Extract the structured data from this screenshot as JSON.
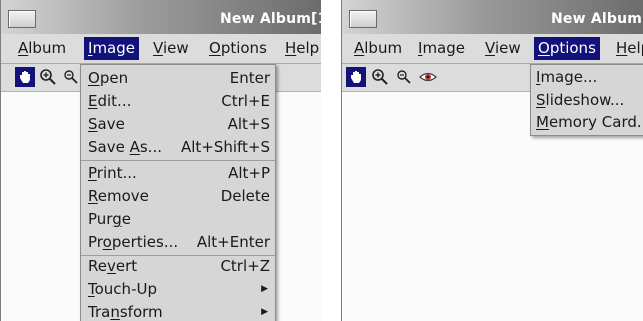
{
  "left": {
    "title": "New Album[1",
    "menus": [
      {
        "u": "A",
        "rest": "lbum"
      },
      {
        "u": "I",
        "rest": "mage"
      },
      {
        "u": "V",
        "rest": "iew"
      },
      {
        "u": "O",
        "rest": "ptions"
      },
      {
        "u": "H",
        "rest": "elp"
      }
    ],
    "active_menu": "Image",
    "toolbar_icons": [
      "hand-icon",
      "zoom-in-icon",
      "zoom-out-icon"
    ],
    "dropdown": [
      {
        "u": "O",
        "rest": "pen",
        "accel": "Enter"
      },
      {
        "u": "E",
        "rest": "dit...",
        "accel": "Ctrl+E"
      },
      {
        "u": "S",
        "rest": "ave",
        "accel": "Alt+S"
      },
      {
        "pre": "Save ",
        "u": "A",
        "rest": "s...",
        "accel": "Alt+Shift+S"
      },
      {
        "u": "P",
        "rest": "rint...",
        "accel": "Alt+P"
      },
      {
        "u": "R",
        "rest": "emove",
        "accel": "Delete"
      },
      {
        "pre": "Pur",
        "u": "g",
        "rest": "e",
        "accel": ""
      },
      {
        "pre": "Pr",
        "u": "o",
        "rest": "perties...",
        "accel": "Alt+Enter"
      },
      {
        "pre": "Re",
        "u": "v",
        "rest": "ert",
        "accel": "Ctrl+Z"
      },
      {
        "u": "T",
        "rest": "ouch-Up",
        "accel": "",
        "submenu": true
      },
      {
        "pre": "Tra",
        "u": "n",
        "rest": "sform",
        "accel": "",
        "submenu": true
      }
    ]
  },
  "right": {
    "title": "New Album",
    "menus": [
      {
        "u": "A",
        "rest": "lbum"
      },
      {
        "u": "I",
        "rest": "mage"
      },
      {
        "u": "V",
        "rest": "iew"
      },
      {
        "u": "O",
        "rest": "ptions"
      },
      {
        "u": "H",
        "rest": "elp"
      }
    ],
    "active_menu": "Options",
    "toolbar_icons": [
      "hand-icon",
      "zoom-in-icon",
      "zoom-out-icon",
      "eye-icon"
    ],
    "dropdown": [
      {
        "u": "I",
        "rest": "mage..."
      },
      {
        "u": "S",
        "rest": "lideshow..."
      },
      {
        "u": "M",
        "rest": "emory Card..."
      }
    ]
  },
  "colors": {
    "highlight": "#12127a",
    "menu_bg": "#dcdcdc",
    "dropdown_bg": "#d6d6d6"
  }
}
